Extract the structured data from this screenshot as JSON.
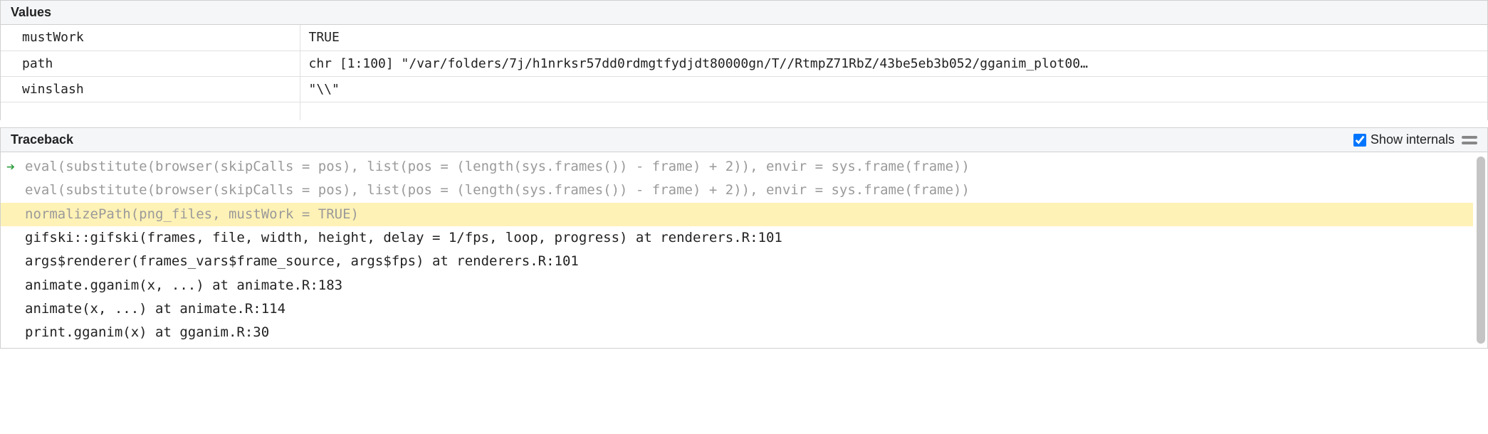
{
  "values": {
    "title": "Values",
    "rows": [
      {
        "name": "mustWork",
        "value": "TRUE"
      },
      {
        "name": "path",
        "value": "chr [1:100] \"/var/folders/7j/h1nrksr57dd0rdmgtfydjdt80000gn/T//RtmpZ71RbZ/43be5eb3b052/gganim_plot00…"
      },
      {
        "name": "winslash",
        "value": "\"\\\\\""
      }
    ]
  },
  "traceback": {
    "title": "Traceback",
    "show_internals_label": "Show internals",
    "show_internals_checked": true,
    "lines": [
      {
        "text": "eval(substitute(browser(skipCalls = pos), list(pos = (length(sys.frames()) - frame) + 2)), envir = sys.frame(frame))",
        "muted": true,
        "arrow": true
      },
      {
        "text": "eval(substitute(browser(skipCalls = pos), list(pos = (length(sys.frames()) - frame) + 2)), envir = sys.frame(frame))",
        "muted": true
      },
      {
        "text": "normalizePath(png_files, mustWork = TRUE)",
        "muted": true,
        "highlight": true
      },
      {
        "text": "gifski::gifski(frames, file, width, height, delay = 1/fps, loop, progress) at renderers.R:101"
      },
      {
        "text": "args$renderer(frames_vars$frame_source, args$fps) at renderers.R:101"
      },
      {
        "text": "animate.gganim(x, ...) at animate.R:183"
      },
      {
        "text": "animate(x, ...) at animate.R:114"
      },
      {
        "text": "print.gganim(x) at gganim.R:30"
      }
    ]
  }
}
